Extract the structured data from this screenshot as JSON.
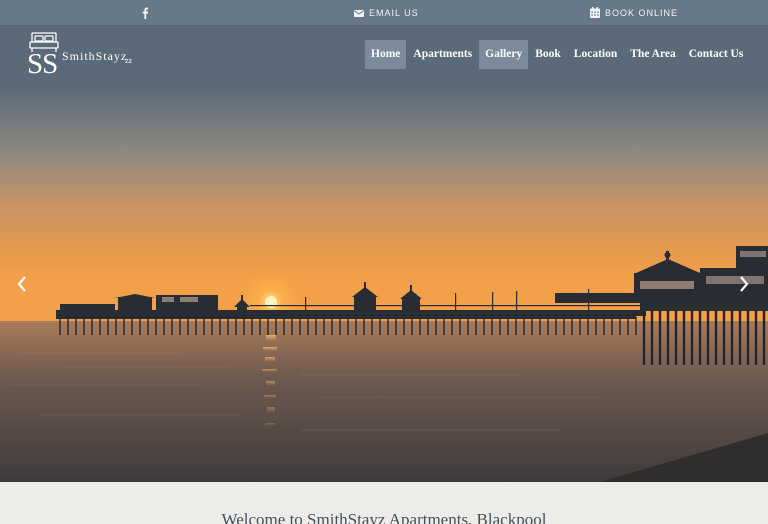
{
  "topbar": {
    "facebook_icon": "facebook-icon",
    "email_label": "EMAIL US",
    "book_label": "BOOK ONLINE"
  },
  "logo": {
    "monogram": "SS",
    "brand": "SmithStayz",
    "suffix": "zz"
  },
  "nav": {
    "items": [
      {
        "label": "Home",
        "highlighted": true
      },
      {
        "label": "Apartments",
        "highlighted": false
      },
      {
        "label": "Gallery",
        "highlighted": true
      },
      {
        "label": "Book",
        "highlighted": false
      },
      {
        "label": "Location",
        "highlighted": false
      },
      {
        "label": "The Area",
        "highlighted": false
      },
      {
        "label": "Contact Us",
        "highlighted": false
      }
    ]
  },
  "hero": {
    "prev_icon": "chevron-left-icon",
    "next_icon": "chevron-right-icon"
  },
  "welcome": {
    "heading": "Welcome to SmithStayz Apartments, Blackpool"
  },
  "colors": {
    "topbar": "#677888",
    "navbar": "#5b6a78",
    "nav_highlight": "#7b8b9b",
    "page_bg": "#eeece8"
  }
}
